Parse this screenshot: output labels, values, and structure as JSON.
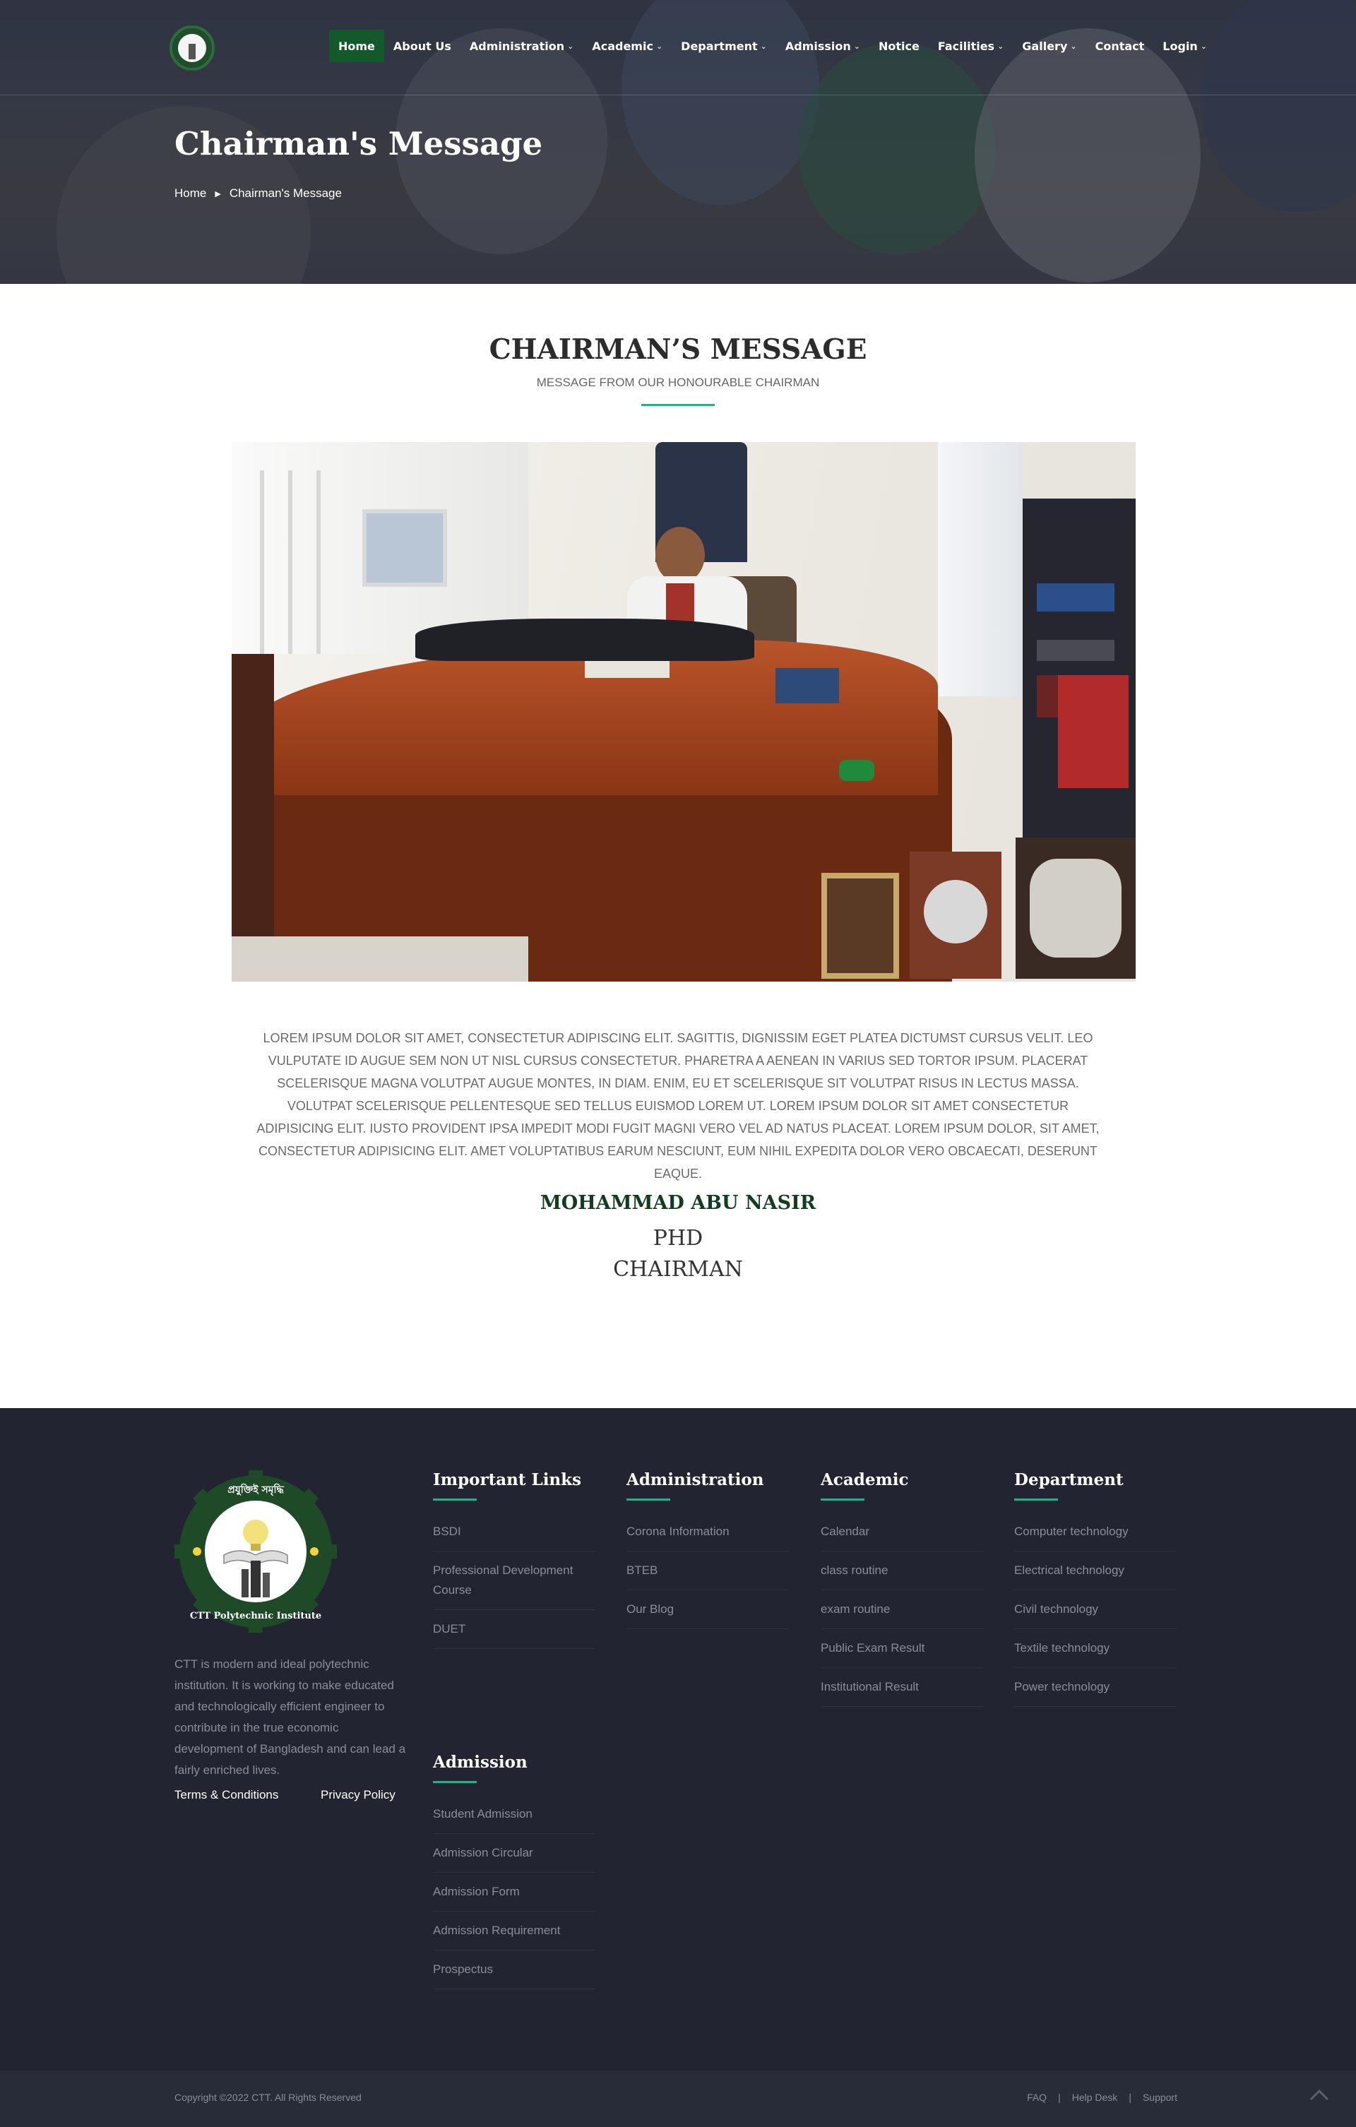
{
  "colors": {
    "accent": "#1bb58a",
    "nav_active": "#125a2c",
    "footer_bg": "#222531",
    "signature_name": "#123d1f"
  },
  "nav": {
    "logo_icon": "institute-logo",
    "items": [
      {
        "label": "Home",
        "active": true,
        "dropdown": false
      },
      {
        "label": "About Us",
        "dropdown": false
      },
      {
        "label": "Administration",
        "dropdown": true
      },
      {
        "label": "Academic",
        "dropdown": true
      },
      {
        "label": "Department",
        "dropdown": true
      },
      {
        "label": "Admission",
        "dropdown": true
      },
      {
        "label": "Notice",
        "dropdown": false
      },
      {
        "label": "Facilities",
        "dropdown": true
      },
      {
        "label": "Gallery",
        "dropdown": true
      },
      {
        "label": "Contact",
        "dropdown": false
      },
      {
        "label": "Login",
        "dropdown": true
      }
    ]
  },
  "hero": {
    "title": "Chairman's Message",
    "breadcrumb": {
      "home": "Home",
      "separator_icon": "triangle-right-icon",
      "current": "Chairman's Message"
    }
  },
  "main": {
    "heading": "CHAIRMAN’S MESSAGE",
    "subheading": "MESSAGE FROM OUR HONOURABLE CHAIRMAN",
    "message": "LOREM IPSUM DOLOR SIT AMET, CONSECTETUR ADIPISCING ELIT. SAGITTIS, DIGNISSIM EGET PLATEA DICTUMST CURSUS VELIT. LEO VULPUTATE ID AUGUE SEM NON UT NISL CURSUS CONSECTETUR. PHARETRA A AENEAN IN VARIUS SED TORTOR IPSUM. PLACERAT SCELERISQUE MAGNA VOLUTPAT AUGUE MONTES, IN DIAM. ENIM, EU ET SCELERISQUE SIT VOLUTPAT RISUS IN LECTUS MASSA. VOLUTPAT SCELERISQUE PELLENTESQUE SED TELLUS EUISMOD LOREM UT. LOREM IPSUM DOLOR SIT AMET CONSECTETUR ADIPISICING ELIT. IUSTO PROVIDENT IPSA IMPEDIT MODI FUGIT MAGNI VERO VEL AD NATUS PLACEAT. LOREM IPSUM DOLOR, SIT AMET, CONSECTETUR ADIPISICING ELIT. AMET VOLUPTATIBUS EARUM NESCIUNT, EUM NIHIL EXPEDITA DOLOR VERO OBCAECATI, DESERUNT EAQUE.",
    "signature": {
      "name": "MOHAMMAD ABU NASIR",
      "degree": "PHD",
      "title": "CHAIRMAN"
    }
  },
  "footer": {
    "logo": {
      "top_text": "প্রযুক্তিই সমৃদ্ধি",
      "ring_text": "CTT Polytechnic Institute"
    },
    "about": "CTT is modern and ideal polytechnic institution. It is working to make educated and technologically efficient engineer to contribute in the true economic development of Bangladesh and can lead a fairly enriched lives.",
    "terms": "Terms & Conditions",
    "privacy": "Privacy Policy",
    "columns": {
      "important": {
        "title": "Important Links",
        "items": [
          "BSDI",
          "Professional Development Course",
          "DUET"
        ]
      },
      "administration": {
        "title": "Administration",
        "items": [
          "Corona Information",
          "BTEB",
          "Our Blog"
        ]
      },
      "academic": {
        "title": "Academic",
        "items": [
          "Calendar",
          "class routine",
          "exam routine",
          "Public Exam Result",
          "Institutional Result"
        ]
      },
      "department": {
        "title": "Department",
        "items": [
          "Computer technology",
          "Electrical technology",
          "Civil technology",
          "Textile technology",
          "Power technology"
        ]
      },
      "admission": {
        "title": "Admission",
        "items": [
          "Student Admission",
          "Admission Circular",
          "Admission Form",
          "Admission Requirement",
          "Prospectus"
        ]
      }
    },
    "copyright": "Copyright ©2022 CTT. All Rights Reserved",
    "bottom_links": [
      "FAQ",
      "Help Desk",
      "Support"
    ],
    "divider": "|"
  }
}
